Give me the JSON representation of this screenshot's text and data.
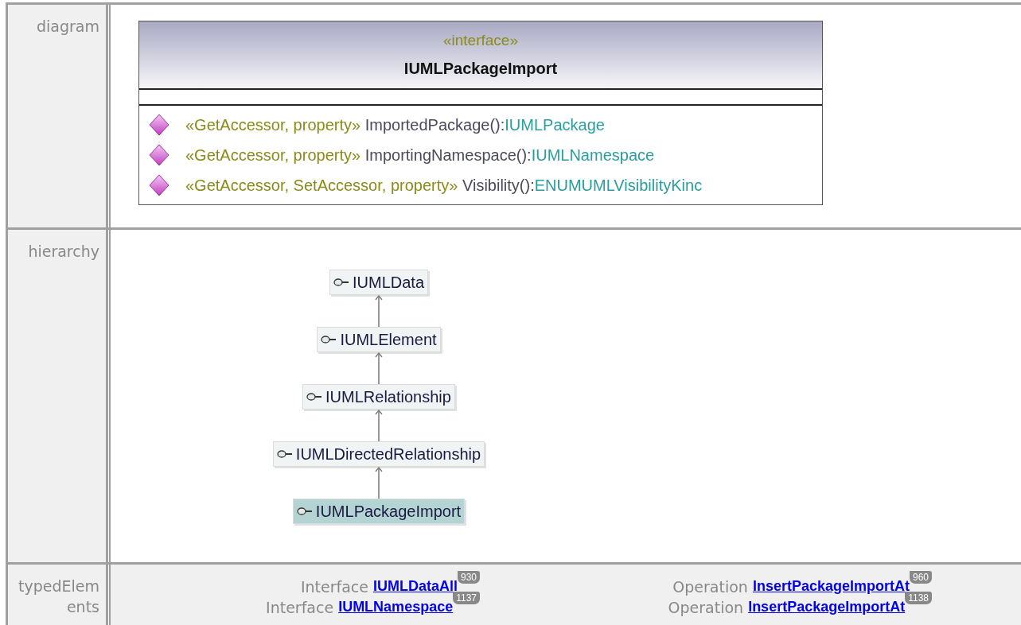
{
  "rows": [
    {
      "label": "diagram",
      "kind": "class",
      "stereotype": "«interface»",
      "name": "IUMLPackageImport",
      "operations": [
        {
          "stereotype": "«GetAccessor, property»",
          "name": "ImportedPackage():",
          "type": "IUMLPackage"
        },
        {
          "stereotype": "«GetAccessor, property»",
          "name": "ImportingNamespace():",
          "type": "IUMLNamespace"
        },
        {
          "stereotype": "«GetAccessor, SetAccessor, property»",
          "name": "Visibility():",
          "type": "ENUMUMLVisibilityKinc"
        }
      ]
    },
    {
      "label": "hierarchy",
      "kind": "hierarchy",
      "nodes": [
        {
          "name": "IUMLData",
          "selected": false
        },
        {
          "name": "IUMLElement",
          "selected": false
        },
        {
          "name": "IUMLRelationship",
          "selected": false
        },
        {
          "name": "IUMLDirectedRelationship",
          "selected": false
        },
        {
          "name": "IUMLPackageImport",
          "selected": true
        }
      ]
    },
    {
      "label": "typedElem ents",
      "kind": "links",
      "columns": [
        [
          {
            "prefix": "Interface",
            "link": "IUMLDataAll",
            "badge": "930"
          },
          {
            "prefix": "Interface",
            "link": "IUMLNamespace",
            "badge": "1137"
          }
        ],
        [
          {
            "prefix": "Operation",
            "link": "InsertPackageImportAt",
            "badge": "960"
          },
          {
            "prefix": "Operation",
            "link": "InsertPackageImportAt",
            "badge": "1138"
          }
        ]
      ]
    }
  ]
}
